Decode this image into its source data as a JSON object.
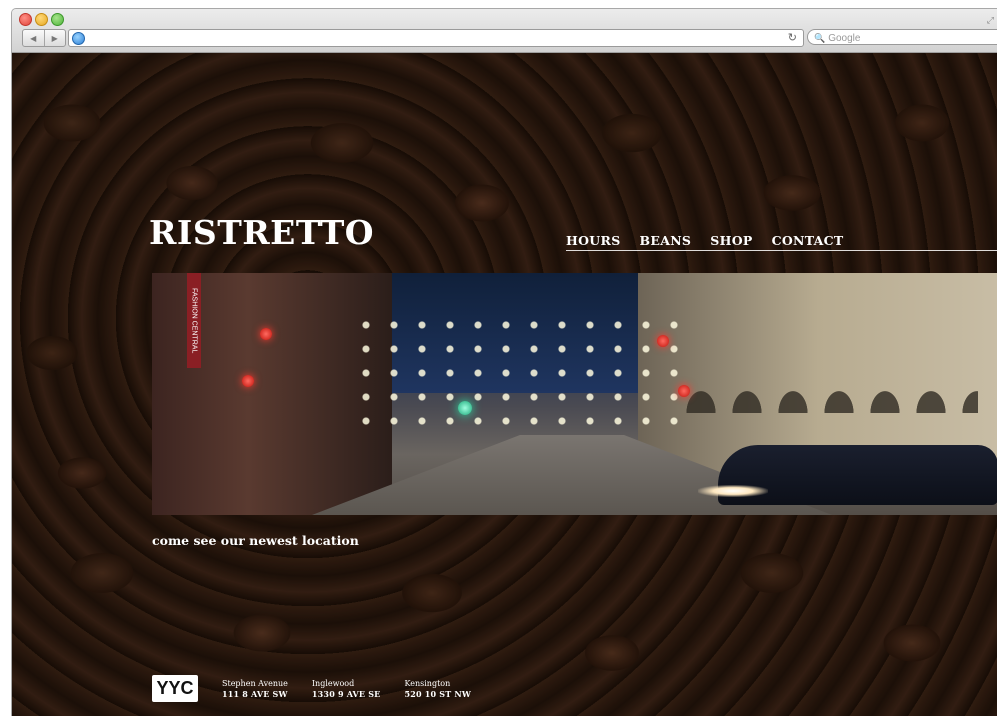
{
  "browser": {
    "url": "",
    "search_placeholder": "Google",
    "back_glyph": "◀",
    "forward_glyph": "▶",
    "reload_glyph": "↻"
  },
  "site": {
    "logo": "RISTRETTO",
    "nav": [
      {
        "label": "HOURS"
      },
      {
        "label": "BEANS"
      },
      {
        "label": "SHOP"
      },
      {
        "label": "CONTACT"
      }
    ],
    "hero_sign": "FASHION CENTRAL",
    "tagline": "come see our newest location",
    "city_badge": "YYC",
    "locations": [
      {
        "name": "Stephen Avenue",
        "address": "111 8 AVE SW"
      },
      {
        "name": "Inglewood",
        "address": "1330 9 AVE SE"
      },
      {
        "name": "Kensington",
        "address": "520 10 ST NW"
      }
    ]
  },
  "colors": {
    "background_tone": "#2a1a10",
    "text": "#ffffff"
  }
}
